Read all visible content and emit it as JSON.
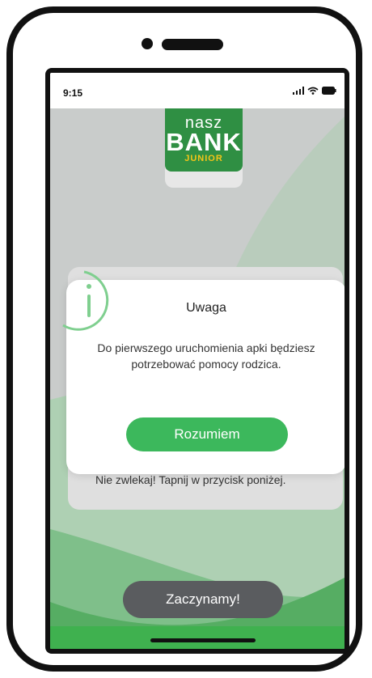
{
  "status": {
    "time": "9:15",
    "icons": [
      "signal-icon",
      "wifi-icon",
      "battery-icon"
    ]
  },
  "logo": {
    "line1": "nasz",
    "line2": "BANK",
    "line3": "JUNIOR"
  },
  "background_text": "Nie zwlekaj! Tapnij w przycisk poniżej.",
  "dialog": {
    "title": "Uwaga",
    "message": "Do pierwszego uruchomienia apki będziesz potrzebować pomocy rodzica.",
    "button_label": "Rozumiem",
    "icon": "info-icon"
  },
  "start_button": {
    "label": "Zaczynamy!"
  },
  "colors": {
    "accent": "#3cb85c",
    "logo_green": "#2f8f43",
    "dark_button": "#5a5c5f"
  }
}
